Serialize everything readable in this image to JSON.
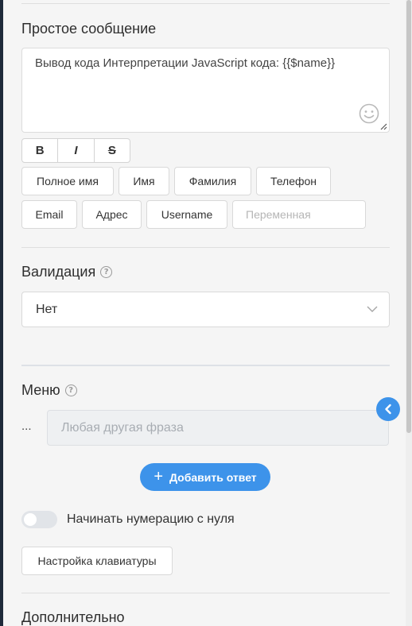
{
  "message": {
    "title": "Простое сообщение",
    "text": "Вывод кода Интерпретации JavaScript кода: {{$name}}"
  },
  "format": {
    "bold": "B",
    "italic": "I",
    "strike": "S"
  },
  "variables": {
    "row1": [
      "Полное имя",
      "Имя",
      "Фамилия",
      "Телефон"
    ],
    "row2": [
      "Email",
      "Адрес",
      "Username"
    ],
    "custom_placeholder": "Переменная"
  },
  "validation": {
    "title": "Валидация",
    "value": "Нет"
  },
  "menu": {
    "title": "Меню",
    "marker": "...",
    "placeholder": "Любая другая фраза",
    "add_label": "Добавить ответ",
    "add_icon": "+"
  },
  "numbering": {
    "label": "Начинать нумерацию с нуля",
    "enabled": false
  },
  "keyboard": {
    "label": "Настройка клавиатуры"
  },
  "additional": {
    "title": "Дополнительно"
  },
  "colors": {
    "accent": "#3d93ea",
    "background": "#f5f5f5"
  }
}
